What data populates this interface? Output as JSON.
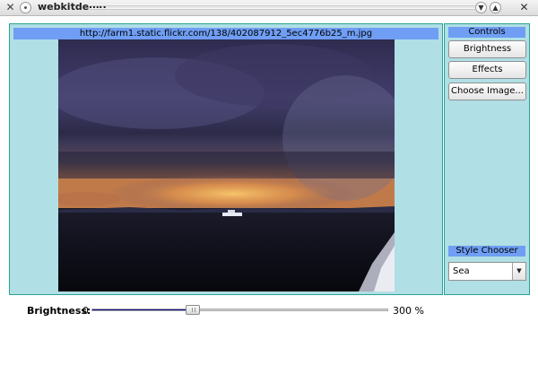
{
  "window": {
    "title": "webkitdemo",
    "minimize_icon": "chevron-down-icon",
    "maximize_icon": "chevron-up-icon",
    "close_icon": "close-icon"
  },
  "image_panel": {
    "url": "http://farm1.static.flickr.com/138/402087912_5ec4776b25_m.jpg",
    "image_description_icon": "stormy-sea-photo"
  },
  "controls": {
    "header": "Controls",
    "buttons": [
      {
        "label": "Brightness"
      },
      {
        "label": "Effects"
      },
      {
        "label": "Choose Image..."
      }
    ]
  },
  "style_chooser": {
    "header": "Style Chooser",
    "selected": "Sea"
  },
  "brightness": {
    "label": "Brightness:",
    "min_label": "0",
    "max_label": "300 %",
    "value_fraction": 0.34
  },
  "colors": {
    "panel_bg": "#b0dfe5",
    "header_bg": "#6f9ef4",
    "slider_fill": "#0a0a8a"
  }
}
